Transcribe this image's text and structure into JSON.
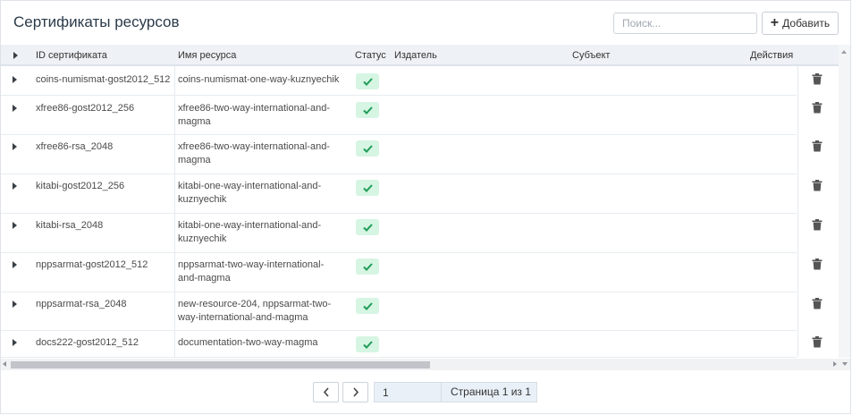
{
  "header": {
    "title": "Сертификаты ресурсов",
    "search_placeholder": "Поиск...",
    "add_label": "Добавить"
  },
  "table": {
    "columns": {
      "id": "ID сертификата",
      "resource": "Имя ресурса",
      "status": "Статус",
      "issuer": "Издатель",
      "subject": "Субъект",
      "actions": "Действия"
    },
    "rows": [
      {
        "id": "coins-numismat-gost2012_512",
        "resource_line1": "coins-numismat-one-way-kuznyechik",
        "resource_line2": "",
        "status": "active"
      },
      {
        "id": "xfree86-gost2012_256",
        "resource_line1": "xfree86-two-way-international-and-",
        "resource_line2": "magma",
        "status": "active"
      },
      {
        "id": "xfree86-rsa_2048",
        "resource_line1": "xfree86-two-way-international-and-",
        "resource_line2": "magma",
        "status": "active"
      },
      {
        "id": "kitabi-gost2012_256",
        "resource_line1": "kitabi-one-way-international-and-",
        "resource_line2": "kuznyechik",
        "status": "active"
      },
      {
        "id": "kitabi-rsa_2048",
        "resource_line1": "kitabi-one-way-international-and-",
        "resource_line2": "kuznyechik",
        "status": "active"
      },
      {
        "id": "nppsarmat-gost2012_512",
        "resource_line1": "nppsarmat-two-way-international-",
        "resource_line2": "and-magma",
        "status": "active"
      },
      {
        "id": "nppsarmat-rsa_2048",
        "resource_line1": "new-resource-204, nppsarmat-two-",
        "resource_line2": "way-international-and-magma",
        "status": "active"
      },
      {
        "id": "docs222-gost2012_512",
        "resource_line1": "documentation-two-way-magma",
        "resource_line2": "",
        "status": "active"
      }
    ]
  },
  "pagination": {
    "page_value": "1",
    "page_info": "Страница 1 из 1"
  },
  "colors": {
    "status_bg": "#d6f5e3",
    "status_check": "#1f9d57",
    "header_bg": "#eef1f5",
    "scroll_thumb": "#c1c4c9"
  },
  "icons": {
    "expand": "caret-right-icon",
    "status": "check-icon",
    "delete": "trash-icon",
    "add": "plus-icon",
    "prev": "chevron-left-icon",
    "next": "chevron-right-icon"
  }
}
